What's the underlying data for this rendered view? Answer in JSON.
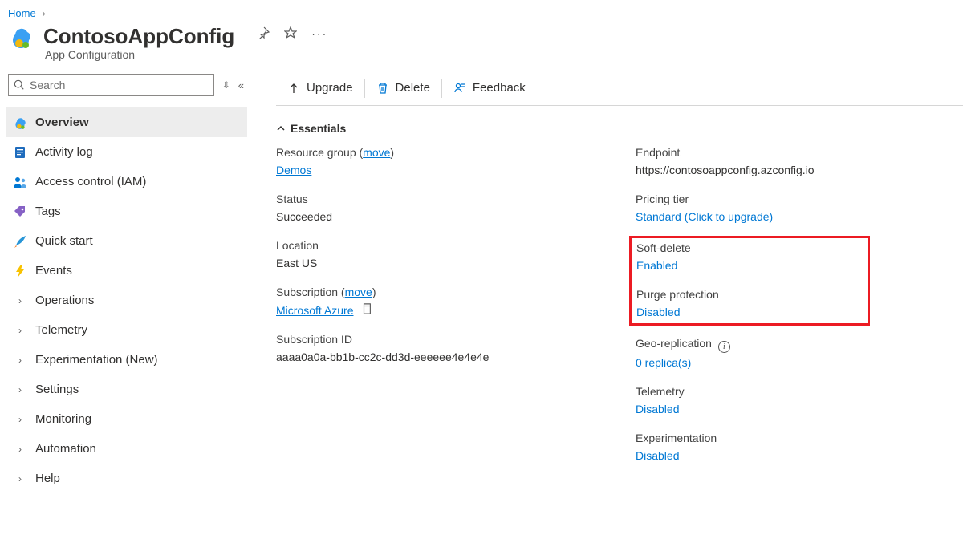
{
  "breadcrumb": {
    "home": "Home"
  },
  "header": {
    "title": "ContosoAppConfig",
    "subtitle": "App Configuration"
  },
  "sidebar": {
    "search_placeholder": "Search",
    "items": [
      {
        "label": "Overview"
      },
      {
        "label": "Activity log"
      },
      {
        "label": "Access control (IAM)"
      },
      {
        "label": "Tags"
      },
      {
        "label": "Quick start"
      },
      {
        "label": "Events"
      },
      {
        "label": "Operations"
      },
      {
        "label": "Telemetry"
      },
      {
        "label": "Experimentation (New)"
      },
      {
        "label": "Settings"
      },
      {
        "label": "Monitoring"
      },
      {
        "label": "Automation"
      },
      {
        "label": "Help"
      }
    ]
  },
  "toolbar": {
    "upgrade": "Upgrade",
    "delete": "Delete",
    "feedback": "Feedback"
  },
  "essentials": {
    "heading": "Essentials",
    "left": {
      "resource_group_label": "Resource group (",
      "resource_group_move": "move",
      "resource_group_label_close": ")",
      "resource_group_value": "Demos",
      "status_label": "Status",
      "status_value": "Succeeded",
      "location_label": "Location",
      "location_value": "East US",
      "subscription_label": "Subscription (",
      "subscription_move": "move",
      "subscription_label_close": ")",
      "subscription_value": "Microsoft Azure",
      "subscription_id_label": "Subscription ID",
      "subscription_id_value": "aaaa0a0a-bb1b-cc2c-dd3d-eeeeee4e4e4e"
    },
    "right": {
      "endpoint_label": "Endpoint",
      "endpoint_value": "https://contosoappconfig.azconfig.io",
      "pricing_label": "Pricing tier",
      "pricing_value": "Standard (Click to upgrade)",
      "soft_delete_label": "Soft-delete",
      "soft_delete_value": "Enabled",
      "purge_label": "Purge protection",
      "purge_value": "Disabled",
      "geo_label": "Geo-replication",
      "geo_value": "0 replica(s)",
      "telemetry_label": "Telemetry",
      "telemetry_value": "Disabled",
      "experimentation_label": "Experimentation",
      "experimentation_value": "Disabled"
    }
  }
}
